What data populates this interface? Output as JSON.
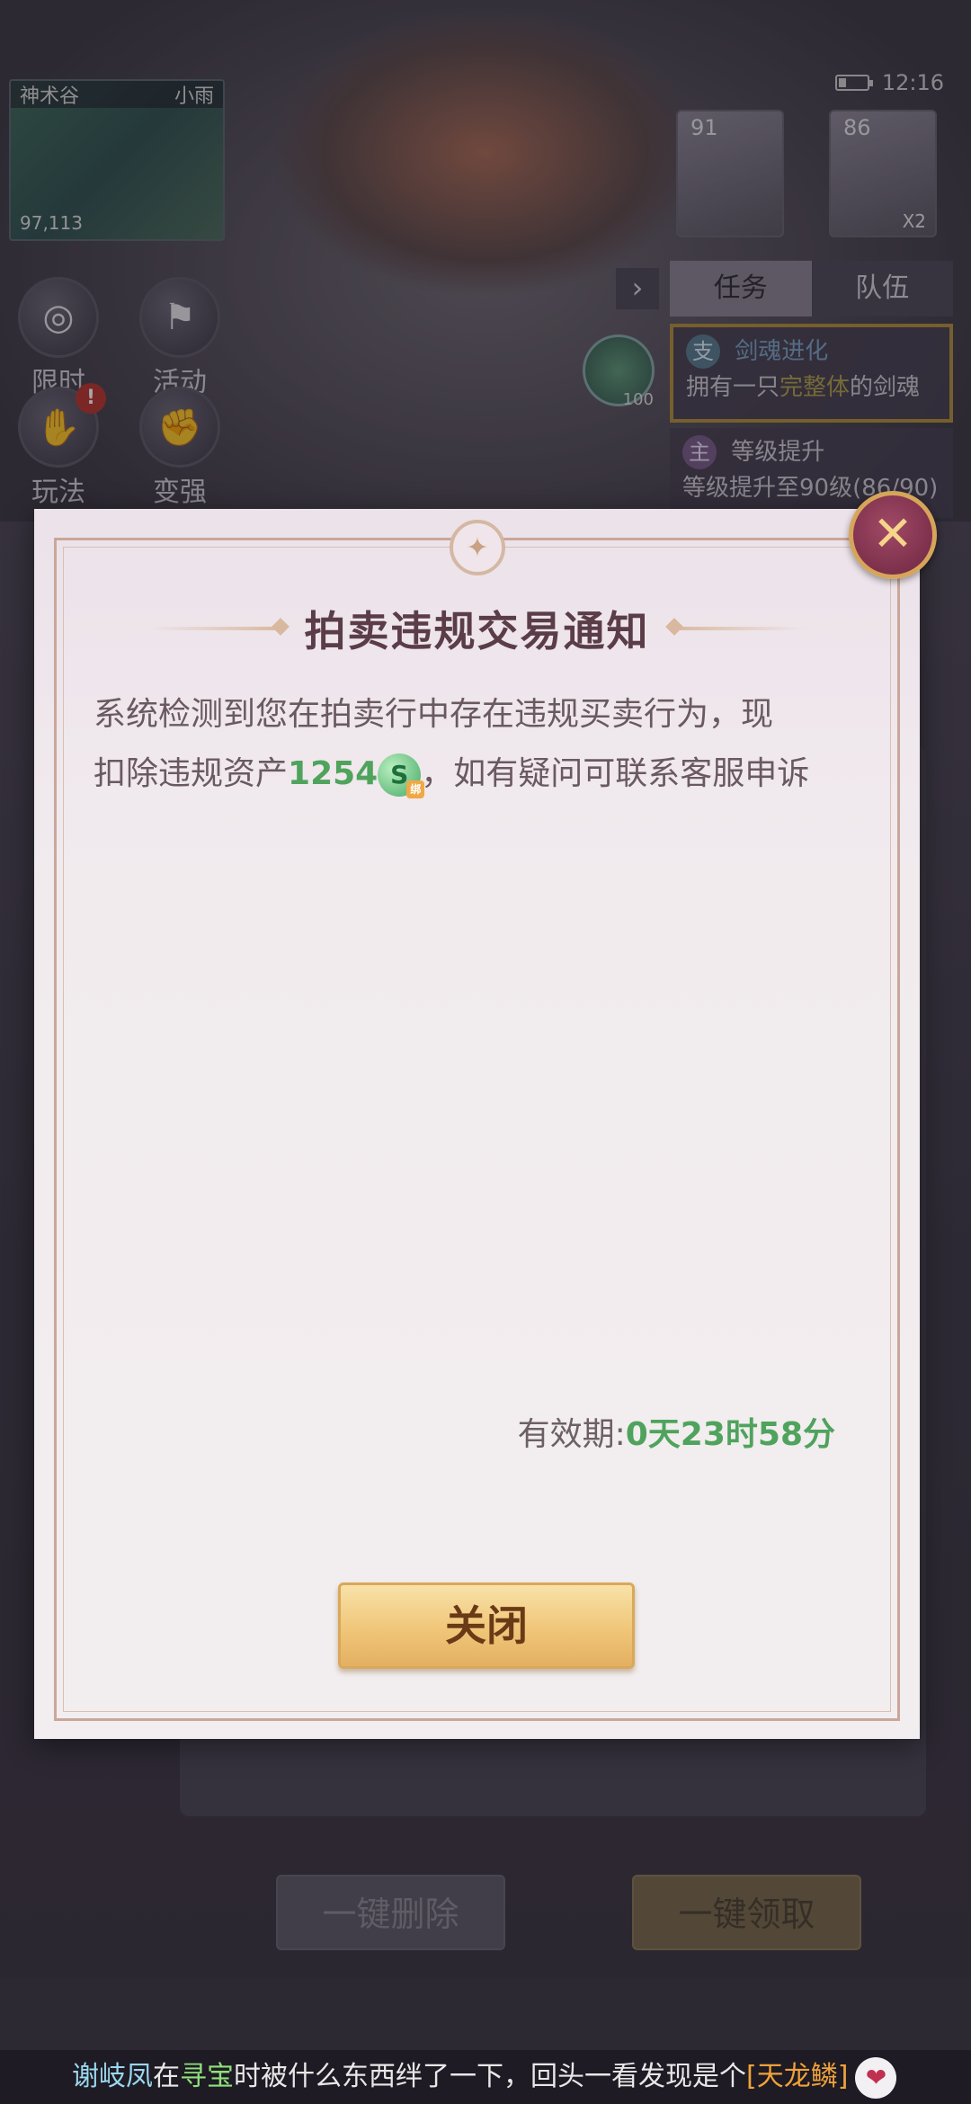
{
  "hud": {
    "map_name": "神术谷",
    "weather": "小雨",
    "coords": "97,113",
    "time": "12:16",
    "buttons": [
      {
        "label": "限时",
        "icon": "limited-time-icon",
        "glyph": "◎"
      },
      {
        "label": "活动",
        "icon": "activity-icon",
        "glyph": "⚑"
      },
      {
        "label": "玩法",
        "icon": "gameplay-icon",
        "glyph": "✋",
        "badge": "!"
      },
      {
        "label": "变强",
        "icon": "power-up-icon",
        "glyph": "✊"
      }
    ],
    "portraits": [
      {
        "level": "91",
        "count": ""
      },
      {
        "level": "86",
        "count": "X2"
      }
    ],
    "side_badge_value": "100"
  },
  "quest_panel": {
    "tabs": [
      "任务",
      "队伍"
    ],
    "active_tab": "任务",
    "items": [
      {
        "tag": "支",
        "title": "剑魂进化",
        "desc_prefix": "拥有一只",
        "desc_highlight": "完整体",
        "desc_suffix": "的剑魂"
      },
      {
        "tag": "主",
        "title": "等级提升",
        "desc": "等级提升至90级(86/90)"
      }
    ]
  },
  "background_buttons": {
    "delete_all": "一键删除",
    "claim_all": "一键领取"
  },
  "modal": {
    "title": "拍卖违规交易通知",
    "message_line1": "系统检测到您在拍卖行中存在违规买卖行为，现",
    "message_line2_prefix": "扣除违规资产",
    "amount": "1254",
    "currency_icon": "jade-coin-icon",
    "bound_tag": "绑",
    "message_line2_suffix": "，如有疑问可联系客服申诉",
    "validity_label": "有效期:",
    "validity_value": "0天23时58分",
    "close_label": "关闭",
    "close_x": "✕"
  },
  "ticker": {
    "player": "谢岐凤",
    "text1": "在",
    "location": "寻宝",
    "text2": "时被什么东西绊了一下，回头一看发现是个",
    "item": "[天龙鳞]",
    "emoji": "❤"
  },
  "colors": {
    "green_value": "#4fa35d",
    "title": "#5b3d48",
    "button_gold": "#f0c679",
    "x_button": "#8a3352"
  }
}
